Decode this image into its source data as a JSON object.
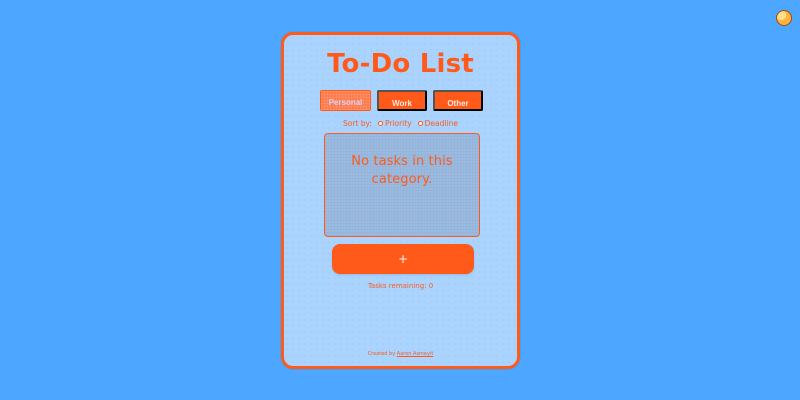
{
  "app": {
    "title": "To-Do List",
    "tabs": [
      {
        "label": "Personal"
      },
      {
        "label": "Work"
      },
      {
        "label": "Other"
      }
    ],
    "sort": {
      "label": "Sort by:",
      "options": [
        {
          "label": "Priority"
        },
        {
          "label": "Deadline"
        }
      ]
    },
    "task_list": {
      "empty_message": "No tasks in this category."
    },
    "add_button": {
      "label": "+"
    },
    "remaining_text": "Tasks remaining: 0",
    "footer": {
      "prefix": "Created by",
      "author": "Aaron Asmeyit"
    }
  },
  "colors": {
    "background": "#4da6ff",
    "card_background": "#a8d4ff",
    "accent": "#ff5a1a",
    "text_on_accent": "#ffffff"
  },
  "icons": {
    "top_right": "palette-icon"
  }
}
